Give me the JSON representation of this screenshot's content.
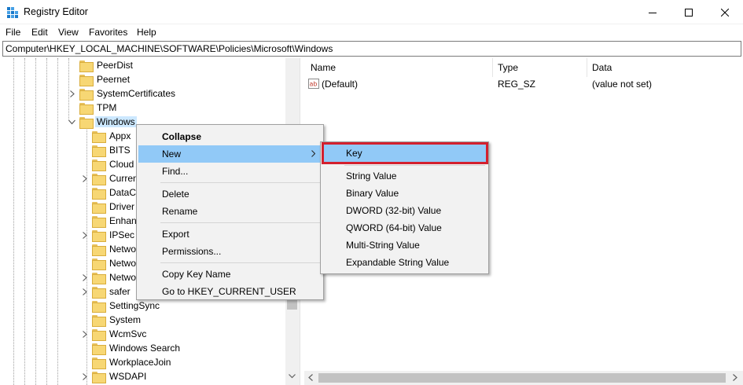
{
  "window": {
    "title": "Registry Editor",
    "accent": "#1979ca"
  },
  "menu": [
    "File",
    "Edit",
    "View",
    "Favorites",
    "Help"
  ],
  "address": "Computer\\HKEY_LOCAL_MACHINE\\SOFTWARE\\Policies\\Microsoft\\Windows",
  "tree": {
    "items": [
      {
        "label": "PeerDist",
        "expander": "none"
      },
      {
        "label": "Peernet",
        "expander": "none"
      },
      {
        "label": "SystemCertificates",
        "expander": "collapsed"
      },
      {
        "label": "TPM",
        "expander": "none"
      },
      {
        "label": "Windows",
        "expander": "expanded",
        "selected": true
      },
      {
        "label": "Appx",
        "expander": "none"
      },
      {
        "label": "BITS",
        "expander": "none"
      },
      {
        "label": "Cloud",
        "expander": "none"
      },
      {
        "label": "Curren",
        "expander": "collapsed"
      },
      {
        "label": "DataC",
        "expander": "none"
      },
      {
        "label": "Driver",
        "expander": "none"
      },
      {
        "label": "Enhan",
        "expander": "none"
      },
      {
        "label": "IPSec",
        "expander": "collapsed"
      },
      {
        "label": "Netwo",
        "expander": "none"
      },
      {
        "label": "Netwo",
        "expander": "none"
      },
      {
        "label": "Netwo",
        "expander": "collapsed"
      },
      {
        "label": "safer",
        "expander": "collapsed"
      },
      {
        "label": "SettingSync",
        "expander": "none"
      },
      {
        "label": "System",
        "expander": "none"
      },
      {
        "label": "WcmSvc",
        "expander": "collapsed"
      },
      {
        "label": "Windows Search",
        "expander": "none"
      },
      {
        "label": "WorkplaceJoin",
        "expander": "none"
      },
      {
        "label": "WSDAPI",
        "expander": "collapsed"
      }
    ]
  },
  "list": {
    "columns": [
      "Name",
      "Type",
      "Data"
    ],
    "rows": [
      {
        "name": "(Default)",
        "type": "REG_SZ",
        "data": "(value not set)",
        "icon": "string-value-icon"
      }
    ]
  },
  "context_menu": {
    "items": [
      {
        "label": "Collapse",
        "bold": true
      },
      {
        "label": "New",
        "submenu": true,
        "highlighted": true
      },
      {
        "label": "Find..."
      },
      {
        "label": "Delete"
      },
      {
        "label": "Rename"
      },
      {
        "label": "Export"
      },
      {
        "label": "Permissions..."
      },
      {
        "label": "Copy Key Name"
      },
      {
        "label": "Go to HKEY_CURRENT_USER"
      }
    ]
  },
  "submenu": {
    "items": [
      {
        "label": "Key",
        "highlighted": true
      },
      {
        "label": "String Value"
      },
      {
        "label": "Binary Value"
      },
      {
        "label": "DWORD (32-bit) Value"
      },
      {
        "label": "QWORD (64-bit) Value"
      },
      {
        "label": "Multi-String Value"
      },
      {
        "label": "Expandable String Value"
      }
    ]
  },
  "colors": {
    "highlight": "#91c9f7",
    "selection": "#cce8ff",
    "annotation": "#d3202e"
  }
}
